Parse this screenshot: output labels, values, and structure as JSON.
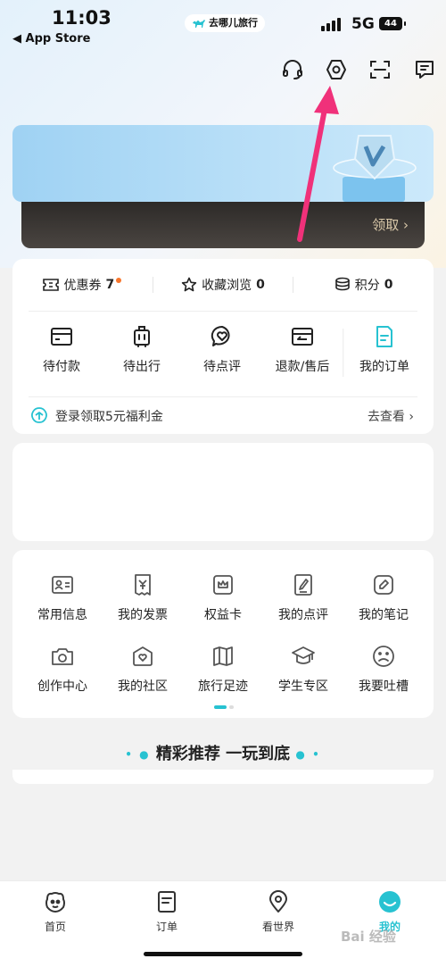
{
  "status_bar": {
    "time": "11:03",
    "back_app": "◀ App Store",
    "app_badge": "去哪儿旅行",
    "network": "5G",
    "battery": "44"
  },
  "header_icons": [
    "headset-icon",
    "settings-icon",
    "scan-icon",
    "message-icon"
  ],
  "membership": {
    "claim_label": "领取 ›"
  },
  "stats": [
    {
      "label": "优惠券",
      "value": "7",
      "icon": "coupon-icon",
      "has_dot": true
    },
    {
      "label": "收藏浏览",
      "value": "0",
      "icon": "star-icon"
    },
    {
      "label": "积分",
      "value": "0",
      "icon": "coins-icon"
    }
  ],
  "orders": [
    {
      "label": "待付款",
      "icon": "card-icon"
    },
    {
      "label": "待出行",
      "icon": "luggage-icon"
    },
    {
      "label": "待点评",
      "icon": "review-bubble-icon"
    },
    {
      "label": "退款/售后",
      "icon": "refund-icon"
    },
    {
      "label": "我的订单",
      "icon": "order-doc-icon"
    }
  ],
  "login_promo": {
    "text": "登录领取5元福利金",
    "action": "去查看 ›"
  },
  "services": [
    {
      "label": "常用信息",
      "icon": "id-card-icon"
    },
    {
      "label": "我的发票",
      "icon": "invoice-icon"
    },
    {
      "label": "权益卡",
      "icon": "crown-card-icon"
    },
    {
      "label": "我的点评",
      "icon": "review-edit-icon"
    },
    {
      "label": "我的笔记",
      "icon": "note-pen-icon"
    },
    {
      "label": "创作中心",
      "icon": "camera-icon"
    },
    {
      "label": "我的社区",
      "icon": "community-house-icon"
    },
    {
      "label": "旅行足迹",
      "icon": "map-book-icon"
    },
    {
      "label": "学生专区",
      "icon": "graduation-cap-icon"
    },
    {
      "label": "我要吐槽",
      "icon": "sad-face-icon"
    }
  ],
  "recommend": {
    "title": "精彩推荐 一玩到底"
  },
  "tabs": [
    {
      "label": "首页",
      "icon": "camel-home-icon"
    },
    {
      "label": "订单",
      "icon": "order-tab-icon"
    },
    {
      "label": "看世界",
      "icon": "location-pin-icon"
    },
    {
      "label": "我的",
      "icon": "smile-profile-icon",
      "active": true
    }
  ],
  "watermark": "Bai 经验",
  "colors": {
    "accent": "#27c2d1",
    "arrow": "#f0317a",
    "notification_dot": "#f7762c"
  }
}
